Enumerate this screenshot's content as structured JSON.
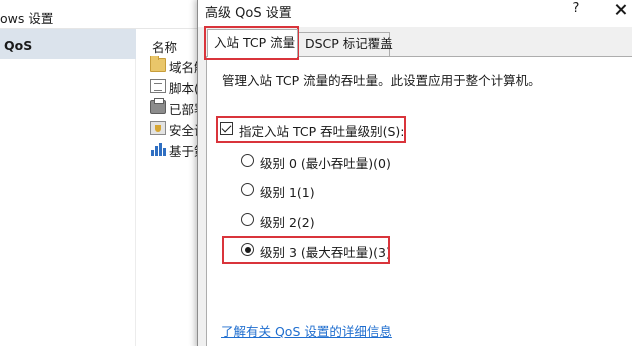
{
  "background_window": {
    "title": "ows 设置",
    "tree_selected": "QoS",
    "list_header": "名称",
    "list_items": [
      {
        "label": "域名解析",
        "icon": "folder-icon"
      },
      {
        "label": "脚本(启动/关机)",
        "icon": "script-icon"
      },
      {
        "label": "已部署的打印机",
        "icon": "printer-icon"
      },
      {
        "label": "安全设置",
        "icon": "security-icon"
      },
      {
        "label": "基于策略的 QoS",
        "icon": "chart-icon"
      }
    ]
  },
  "dialog": {
    "title": "高级 QoS 设置",
    "help_glyph": "?",
    "tabs": [
      {
        "label": "入站 TCP 流量",
        "active": true
      },
      {
        "label": "DSCP 标记覆盖",
        "active": false
      }
    ],
    "description": "管理入站 TCP 流量的吞吐量。此设置应用于整个计算机。",
    "checkbox": {
      "label": "指定入站 TCP 吞吐量级别(S):",
      "checked": true
    },
    "radio_options": [
      {
        "label": "级别 0 (最小吞吐量)(0)",
        "selected": false
      },
      {
        "label": "级别 1(1)",
        "selected": false
      },
      {
        "label": "级别 2(2)",
        "selected": false
      },
      {
        "label": "级别 3 (最大吞吐量)(3)",
        "selected": true
      }
    ],
    "help_link": "了解有关 QoS 设置的详细信息"
  },
  "colors": {
    "annotation": "#d9343b",
    "link": "#1f6ecf",
    "tree_selection": "#dbe3ec",
    "dialog_bg": "#f0f0f0"
  }
}
